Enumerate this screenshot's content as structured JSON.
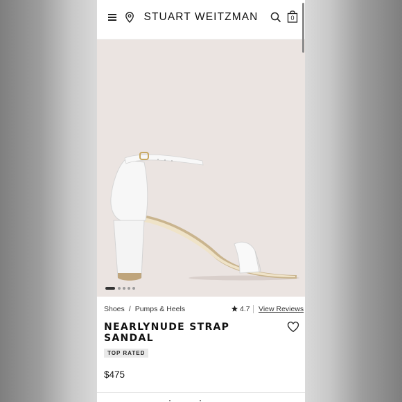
{
  "header": {
    "brand": "STUART WEITZMAN",
    "icons": [
      "menu-icon",
      "location-pin-icon",
      "search-icon",
      "shopping-bag-icon"
    ],
    "bag_count": "0"
  },
  "gallery": {
    "image_label": "white strap sandal with block heel",
    "slide_count": 5,
    "active_slide": 1
  },
  "breadcrumb": [
    "Shoes",
    "Pumps & Heels"
  ],
  "breadcrumb_separator": "/",
  "rating": {
    "value": "4.7",
    "link_label": "View Reviews"
  },
  "product": {
    "name": "NEARLYNUDE STRAP SANDAL",
    "badge": "TOP RATED",
    "price": "$475"
  },
  "colors": {
    "hero_background": "#ebe4e1",
    "text": "#111111",
    "badge_background": "#e9e9e9"
  }
}
